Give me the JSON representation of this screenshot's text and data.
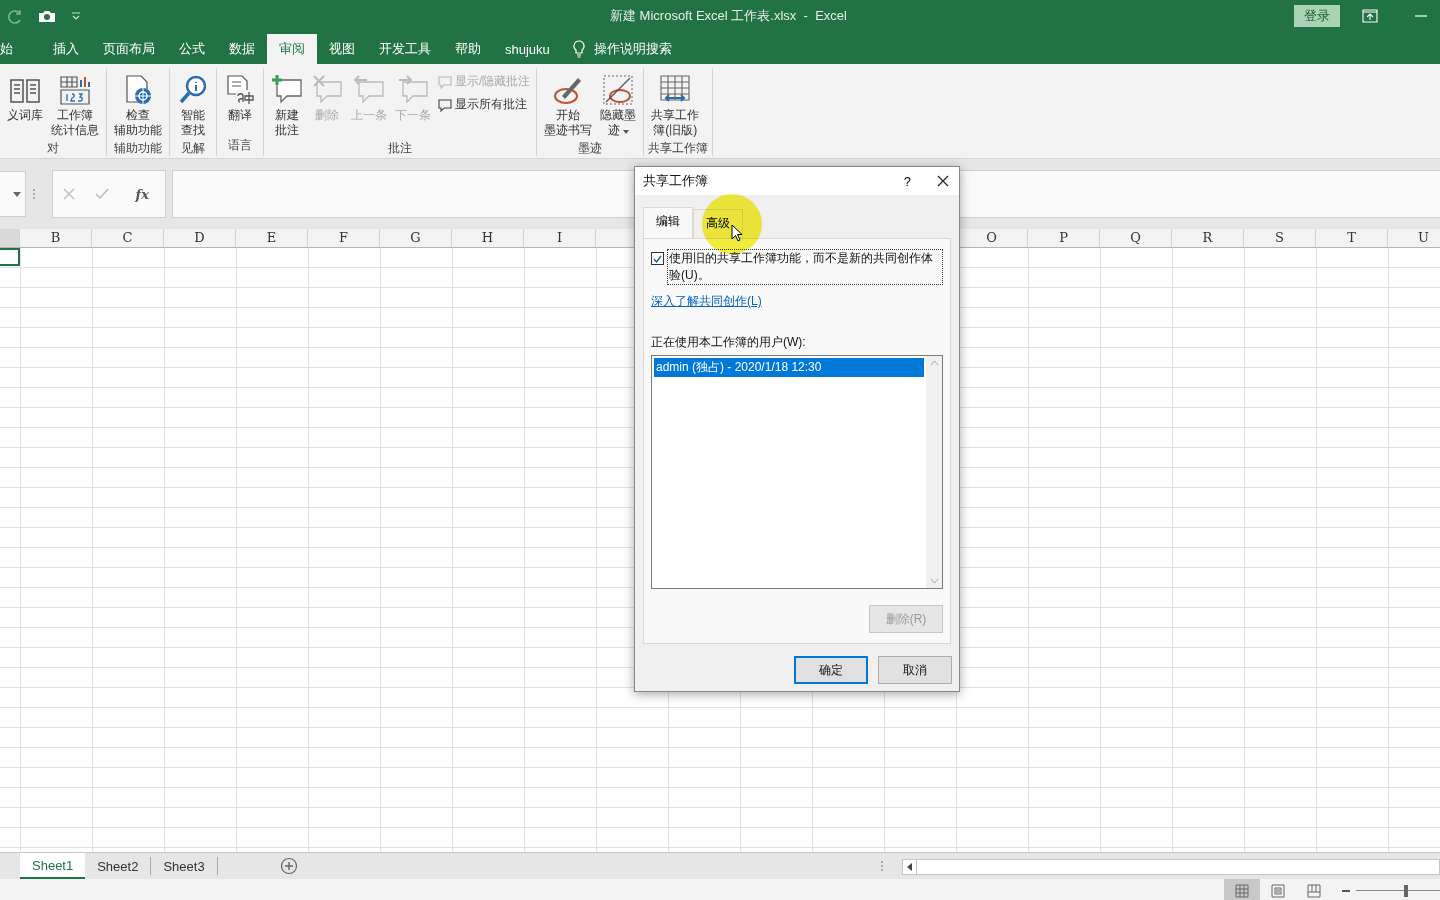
{
  "title_bar": {
    "title": "新建 Microsoft Excel 工作表.xlsx  -  Excel",
    "login_button": "登录"
  },
  "ribbon_tabs": [
    {
      "label": "始",
      "selected": false
    },
    {
      "label": "插入",
      "selected": false
    },
    {
      "label": "页面布局",
      "selected": false
    },
    {
      "label": "公式",
      "selected": false
    },
    {
      "label": "数据",
      "selected": false
    },
    {
      "label": "审阅",
      "selected": true
    },
    {
      "label": "视图",
      "selected": false
    },
    {
      "label": "开发工具",
      "selected": false
    },
    {
      "label": "帮助",
      "selected": false
    },
    {
      "label": "shujuku",
      "selected": false
    }
  ],
  "tell_me": "操作说明搜索",
  "ribbon_groups": [
    {
      "label": "对",
      "buttons": [
        {
          "kind": "large",
          "lines": [
            "义词库"
          ],
          "disabled": false,
          "has_menu": false
        },
        {
          "kind": "large",
          "lines": [
            "工作簿",
            "统计信息"
          ],
          "disabled": false,
          "has_menu": false
        }
      ]
    },
    {
      "label": "辅助功能",
      "buttons": [
        {
          "kind": "large",
          "lines": [
            "检查",
            "辅助功能"
          ],
          "disabled": false,
          "has_menu": false
        }
      ]
    },
    {
      "label": "见解",
      "buttons": [
        {
          "kind": "large",
          "lines": [
            "智能",
            "查找"
          ],
          "disabled": false,
          "has_menu": false
        }
      ]
    },
    {
      "label": "语言",
      "buttons": [
        {
          "kind": "large",
          "lines": [
            "翻译"
          ],
          "disabled": false,
          "has_menu": false
        }
      ]
    },
    {
      "label": "批注",
      "buttons": [
        {
          "kind": "large",
          "lines": [
            "新建",
            "批注"
          ],
          "disabled": false,
          "has_menu": false
        },
        {
          "kind": "large",
          "lines": [
            "删除"
          ],
          "disabled": true,
          "has_menu": false
        },
        {
          "kind": "large",
          "lines": [
            "上一条"
          ],
          "disabled": true,
          "has_menu": false
        },
        {
          "kind": "large",
          "lines": [
            "下一条"
          ],
          "disabled": true,
          "has_menu": false
        },
        {
          "kind": "small",
          "lines": [
            "显示/隐藏批注"
          ],
          "disabled": true,
          "has_menu": false
        },
        {
          "kind": "small",
          "lines": [
            "显示所有批注"
          ],
          "disabled": false,
          "has_menu": false
        }
      ]
    },
    {
      "label": "墨迹",
      "buttons": [
        {
          "kind": "large",
          "lines": [
            "开始",
            "墨迹书写"
          ],
          "disabled": false,
          "has_menu": false
        },
        {
          "kind": "large",
          "lines": [
            "隐藏墨",
            "迹"
          ],
          "disabled": false,
          "has_menu": true
        }
      ]
    },
    {
      "label": "共享工作簿",
      "buttons": [
        {
          "kind": "large",
          "lines": [
            "共享工作",
            "簿(旧版)"
          ],
          "disabled": false,
          "has_menu": false
        }
      ]
    }
  ],
  "formula_bar": {
    "function_label": "fx"
  },
  "columns_left": [
    "B",
    "C",
    "D",
    "E",
    "F",
    "G",
    "H",
    "I"
  ],
  "columns_right": [
    "O",
    "P",
    "Q",
    "R",
    "S",
    "T",
    "U"
  ],
  "sheets": [
    {
      "label": "Sheet1",
      "selected": true
    },
    {
      "label": "Sheet2",
      "selected": false
    },
    {
      "label": "Sheet3",
      "selected": false
    }
  ],
  "status_bar": {
    "views": [
      {
        "selected": true
      },
      {
        "selected": false
      },
      {
        "selected": false
      }
    ],
    "zoom": {
      "level": 0.6
    }
  },
  "dialog": {
    "title": "共享工作簿",
    "help": "?",
    "tabs": [
      {
        "label": "编辑",
        "selected": true
      },
      {
        "label": "高级",
        "selected": false
      }
    ],
    "option": {
      "label": "使用旧的共享工作簿功能，而不是新的共同创作体验(U)。",
      "checked": true
    },
    "link": "深入了解共同创作(L)",
    "users_label": "正在使用本工作簿的用户(W):",
    "users": [
      {
        "label": "admin (独占) - 2020/1/18 12:30",
        "selected": true
      }
    ],
    "remove_button": {
      "label": "删除(R)",
      "disabled": true
    },
    "ok_button": "确定",
    "cancel_button": "取消"
  }
}
